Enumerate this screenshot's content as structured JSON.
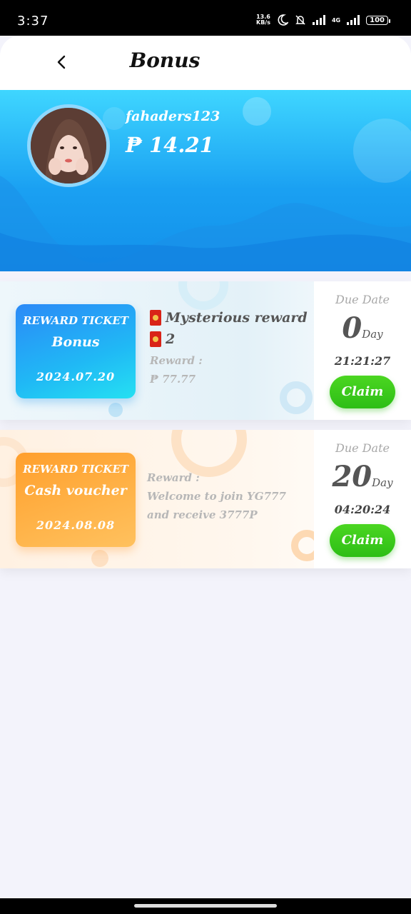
{
  "status_bar": {
    "time": "3:37",
    "net_speed_value": "13.6",
    "net_speed_unit": "KB/s",
    "network": "4G",
    "battery": "100"
  },
  "header": {
    "title": "Bonus",
    "back_icon": "chevron-left-icon"
  },
  "profile": {
    "username": "fahaders123",
    "balance": "₱ 14.21"
  },
  "tickets": [
    {
      "badge_heading": "REWARD TICKET",
      "badge_type": "Bonus",
      "badge_date": "2024.07.20",
      "line1": "Mysterious reward",
      "line2": "2",
      "reward_label": "Reward :",
      "reward_value": "₱ 77.77",
      "due_label": "Due Date",
      "due_days": "0",
      "due_unit": "Day",
      "due_time": "21:21:27",
      "claim_label": "Claim"
    },
    {
      "badge_heading": "REWARD TICKET",
      "badge_type": "Cash voucher",
      "badge_date": "2024.08.08",
      "reward_label": "Reward :",
      "reward_desc_line1": "Welcome to join YG777",
      "reward_desc_line2": "and receive 3777P",
      "due_label": "Due Date",
      "due_days": "20",
      "due_unit": "Day",
      "due_time": "04:20:24",
      "claim_label": "Claim"
    }
  ],
  "colors": {
    "banner_top": "#3fd6ff",
    "banner_bottom": "#1290ea",
    "claim_green": "#2dbe16",
    "ticket_blue": "#2b8af7",
    "ticket_orange": "#ff9f2c"
  }
}
